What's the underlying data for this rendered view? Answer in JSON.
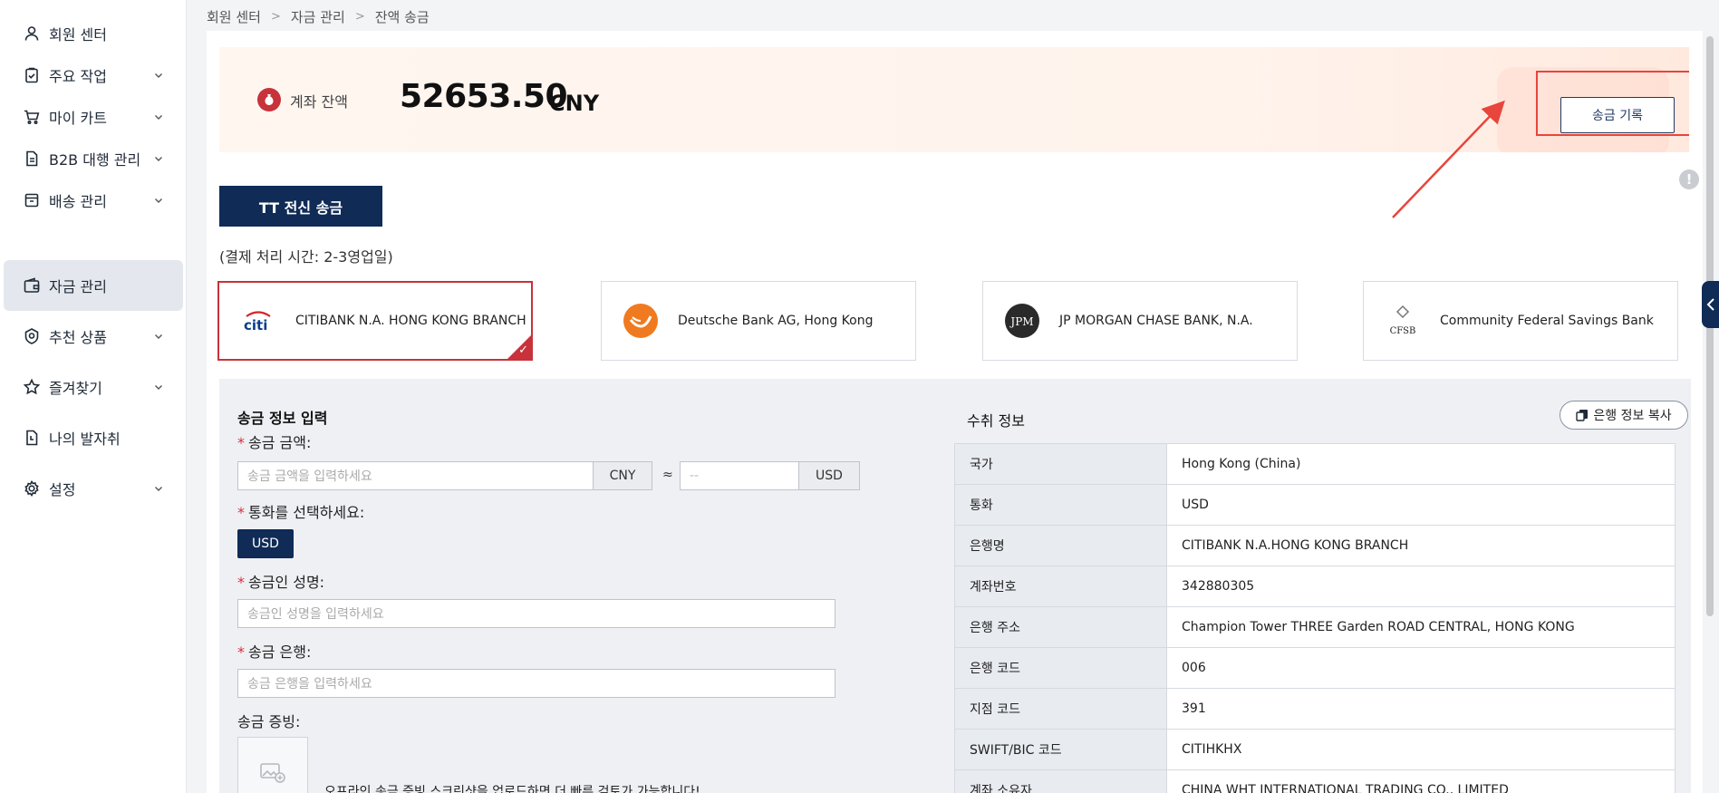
{
  "sidebar": {
    "items": [
      {
        "label": "회원 센터",
        "icon": "user-icon",
        "has_chevron": false
      },
      {
        "label": "주요 작업",
        "icon": "clipboard-check-icon",
        "has_chevron": true
      },
      {
        "label": "마이 카트",
        "icon": "cart-icon",
        "has_chevron": true
      },
      {
        "label": "B2B 대행 관리",
        "icon": "document-icon",
        "has_chevron": true
      },
      {
        "label": "배송 관리",
        "icon": "box-icon",
        "has_chevron": true
      },
      {
        "label": "자금 관리",
        "icon": "wallet-icon",
        "has_chevron": false,
        "active": true
      },
      {
        "label": "추천 상품",
        "icon": "badge-icon",
        "has_chevron": true
      },
      {
        "label": "즐겨찾기",
        "icon": "star-icon",
        "has_chevron": true
      },
      {
        "label": "나의 발자취",
        "icon": "footprint-icon",
        "has_chevron": false
      },
      {
        "label": "설정",
        "icon": "gear-icon",
        "has_chevron": true
      }
    ]
  },
  "breadcrumb": [
    "회원 센터",
    "자금 관리",
    "잔액 송금"
  ],
  "balance": {
    "label": "계좌 잔액",
    "amount": "52653.50",
    "currency": "CNY",
    "history_button": "송금 기록"
  },
  "tab_label": "TT 전신 송금",
  "processing_time": "(결제 처리 시간: 2-3영업일)",
  "banks": [
    {
      "name": "CITIBANK N.A. HONG KONG BRANCH",
      "logo": "citi-logo",
      "selected": true
    },
    {
      "name": "Deutsche Bank AG, Hong Kong",
      "logo": "deutsche-logo",
      "selected": false
    },
    {
      "name": "JP MORGAN CHASE BANK, N.A.",
      "logo": "jpm-logo",
      "selected": false
    },
    {
      "name": "Community Federal Savings Bank",
      "logo": "cfsb-logo",
      "selected": false
    }
  ],
  "form": {
    "title": "송금 정보 입력",
    "amount_label": "송금 금액:",
    "amount_placeholder": "송금 금액을 입력하세요",
    "amount_currency": "CNY",
    "approx": "≈",
    "converted_placeholder": "--",
    "converted_currency": "USD",
    "currency_label": "통화를 선택하세요:",
    "currency_option": "USD",
    "remitter_label": "송금인 성명:",
    "remitter_placeholder": "송금인 성명을 입력하세요",
    "bank_label": "송금 은행:",
    "bank_placeholder": "송금 은행을 입력하세요",
    "proof_label": "송금 증빙:",
    "proof_note": "오프라인 송금 증빙 스크린샷을 업로드하면 더 빠른 검토가 가능합니다!"
  },
  "receiver": {
    "title": "수취 정보",
    "copy_button": "은행 정보 복사",
    "rows": [
      {
        "key": "국가",
        "value": "Hong Kong (China)"
      },
      {
        "key": "통화",
        "value": "USD"
      },
      {
        "key": "은행명",
        "value": "CITIBANK N.A.HONG KONG BRANCH"
      },
      {
        "key": "계좌번호",
        "value": "342880305"
      },
      {
        "key": "은행 주소",
        "value": "Champion Tower THREE Garden ROAD CENTRAL, HONG KONG"
      },
      {
        "key": "은행 코드",
        "value": "006"
      },
      {
        "key": "지점 코드",
        "value": "391"
      },
      {
        "key": "SWIFT/BIC 코드",
        "value": "CITIHKHX"
      },
      {
        "key": "계좌 소유자",
        "value": "CHINA WHT INTERNATIONAL TRADING CO., LIMITED"
      }
    ]
  },
  "colors": {
    "navy": "#0f2b56",
    "highlight": "#e8453c",
    "selected_border": "#c8323a"
  }
}
